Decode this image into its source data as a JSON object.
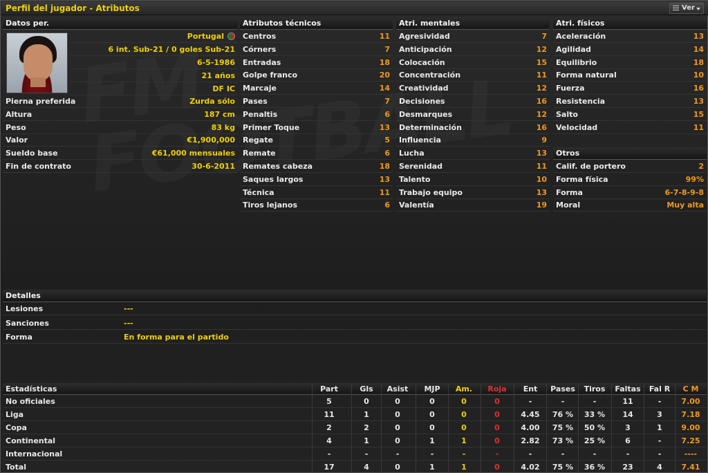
{
  "window": {
    "title": "Perfil del jugador - Atributos",
    "ver_label": "Ver"
  },
  "personal": {
    "header": "Datos per.",
    "nationality": "Portugal",
    "caps": "6 int. Sub-21 / 0 goles Sub-21",
    "dob": "6-5-1986",
    "age": "21 años",
    "position": "DF IC",
    "rows": [
      {
        "label": "Pierna preferida",
        "value": "Zurda sólo"
      },
      {
        "label": "Altura",
        "value": "187 cm"
      },
      {
        "label": "Peso",
        "value": "83 kg"
      },
      {
        "label": "Valor",
        "value": "€1,900,000"
      },
      {
        "label": "Sueldo base",
        "value": "€61,000 mensuales"
      },
      {
        "label": "Fin de contrato",
        "value": "30-6-2011"
      }
    ]
  },
  "technical": {
    "header": "Atributos técnicos",
    "rows": [
      {
        "label": "Centros",
        "value": "11"
      },
      {
        "label": "Córners",
        "value": "7"
      },
      {
        "label": "Entradas",
        "value": "18"
      },
      {
        "label": "Golpe franco",
        "value": "20"
      },
      {
        "label": "Marcaje",
        "value": "14"
      },
      {
        "label": "Pases",
        "value": "7"
      },
      {
        "label": "Penaltis",
        "value": "6"
      },
      {
        "label": "Primer Toque",
        "value": "13"
      },
      {
        "label": "Regate",
        "value": "5"
      },
      {
        "label": "Remate",
        "value": "6"
      },
      {
        "label": "Remates cabeza",
        "value": "18"
      },
      {
        "label": "Saques largos",
        "value": "13"
      },
      {
        "label": "Técnica",
        "value": "11"
      },
      {
        "label": "Tiros lejanos",
        "value": "6"
      }
    ]
  },
  "mental": {
    "header": "Atri. mentales",
    "rows": [
      {
        "label": "Agresividad",
        "value": "7"
      },
      {
        "label": "Anticipación",
        "value": "12"
      },
      {
        "label": "Colocación",
        "value": "15"
      },
      {
        "label": "Concentración",
        "value": "11"
      },
      {
        "label": "Creatividad",
        "value": "12"
      },
      {
        "label": "Decisiones",
        "value": "16"
      },
      {
        "label": "Desmarques",
        "value": "12"
      },
      {
        "label": "Determinación",
        "value": "16"
      },
      {
        "label": "Influencia",
        "value": "9"
      },
      {
        "label": "Lucha",
        "value": "13"
      },
      {
        "label": "Serenidad",
        "value": "11"
      },
      {
        "label": "Talento",
        "value": "10"
      },
      {
        "label": "Trabajo equipo",
        "value": "13"
      },
      {
        "label": "Valentía",
        "value": "19"
      }
    ]
  },
  "physical": {
    "header": "Atri. físicos",
    "rows": [
      {
        "label": "Aceleración",
        "value": "13"
      },
      {
        "label": "Agilidad",
        "value": "14"
      },
      {
        "label": "Equilibrio",
        "value": "18"
      },
      {
        "label": "Forma natural",
        "value": "10"
      },
      {
        "label": "Fuerza",
        "value": "16"
      },
      {
        "label": "Resistencia",
        "value": "13"
      },
      {
        "label": "Salto",
        "value": "15"
      },
      {
        "label": "Velocidad",
        "value": "11"
      }
    ]
  },
  "others": {
    "header": "Otros",
    "rows": [
      {
        "label": "Calif. de portero",
        "value": "2"
      },
      {
        "label": "Forma física",
        "value": "99%"
      },
      {
        "label": "Forma",
        "value": "6-7-8-9-8"
      },
      {
        "label": "Moral",
        "value": "Muy alta"
      }
    ]
  },
  "details": {
    "header": "Detalles",
    "rows": [
      {
        "label": "Lesiones",
        "value": "---"
      },
      {
        "label": "Sanciones",
        "value": "---"
      },
      {
        "label": "Forma",
        "value": "En forma para el partido"
      }
    ]
  },
  "stats": {
    "header": "Estadísticas",
    "columns": [
      "Part",
      "Gls",
      "Asist",
      "MJP",
      "Am.",
      "Roja",
      "Ent",
      "Pases",
      "Tiros",
      "Faltas",
      "Fal R",
      "C M"
    ],
    "rows": [
      {
        "name": "No oficiales",
        "cells": [
          "5",
          "0",
          "0",
          "0",
          "0",
          "0",
          "-",
          "-",
          "-",
          "11",
          "-",
          "7.00"
        ]
      },
      {
        "name": "Liga",
        "cells": [
          "11",
          "1",
          "0",
          "0",
          "0",
          "0",
          "4.45",
          "76 %",
          "33 %",
          "14",
          "3",
          "7.18"
        ]
      },
      {
        "name": "Copa",
        "cells": [
          "2",
          "2",
          "0",
          "0",
          "0",
          "0",
          "4.00",
          "75 %",
          "50 %",
          "3",
          "1",
          "9.00"
        ]
      },
      {
        "name": "Continental",
        "cells": [
          "4",
          "1",
          "0",
          "1",
          "1",
          "0",
          "2.82",
          "73 %",
          "25 %",
          "6",
          "-",
          "7.25"
        ]
      },
      {
        "name": "Internacional",
        "cells": [
          "-",
          "-",
          "-",
          "-",
          "-",
          "-",
          "-",
          "-",
          "-",
          "-",
          "-",
          "----"
        ]
      },
      {
        "name": "Total",
        "cells": [
          "17",
          "4",
          "0",
          "1",
          "1",
          "0",
          "4.02",
          "75 %",
          "36 %",
          "23",
          "4",
          "7.41"
        ]
      }
    ]
  },
  "colors": {
    "highlight": "#f0d000",
    "attribute": "#f09a1a",
    "red_card": "#e03030"
  }
}
